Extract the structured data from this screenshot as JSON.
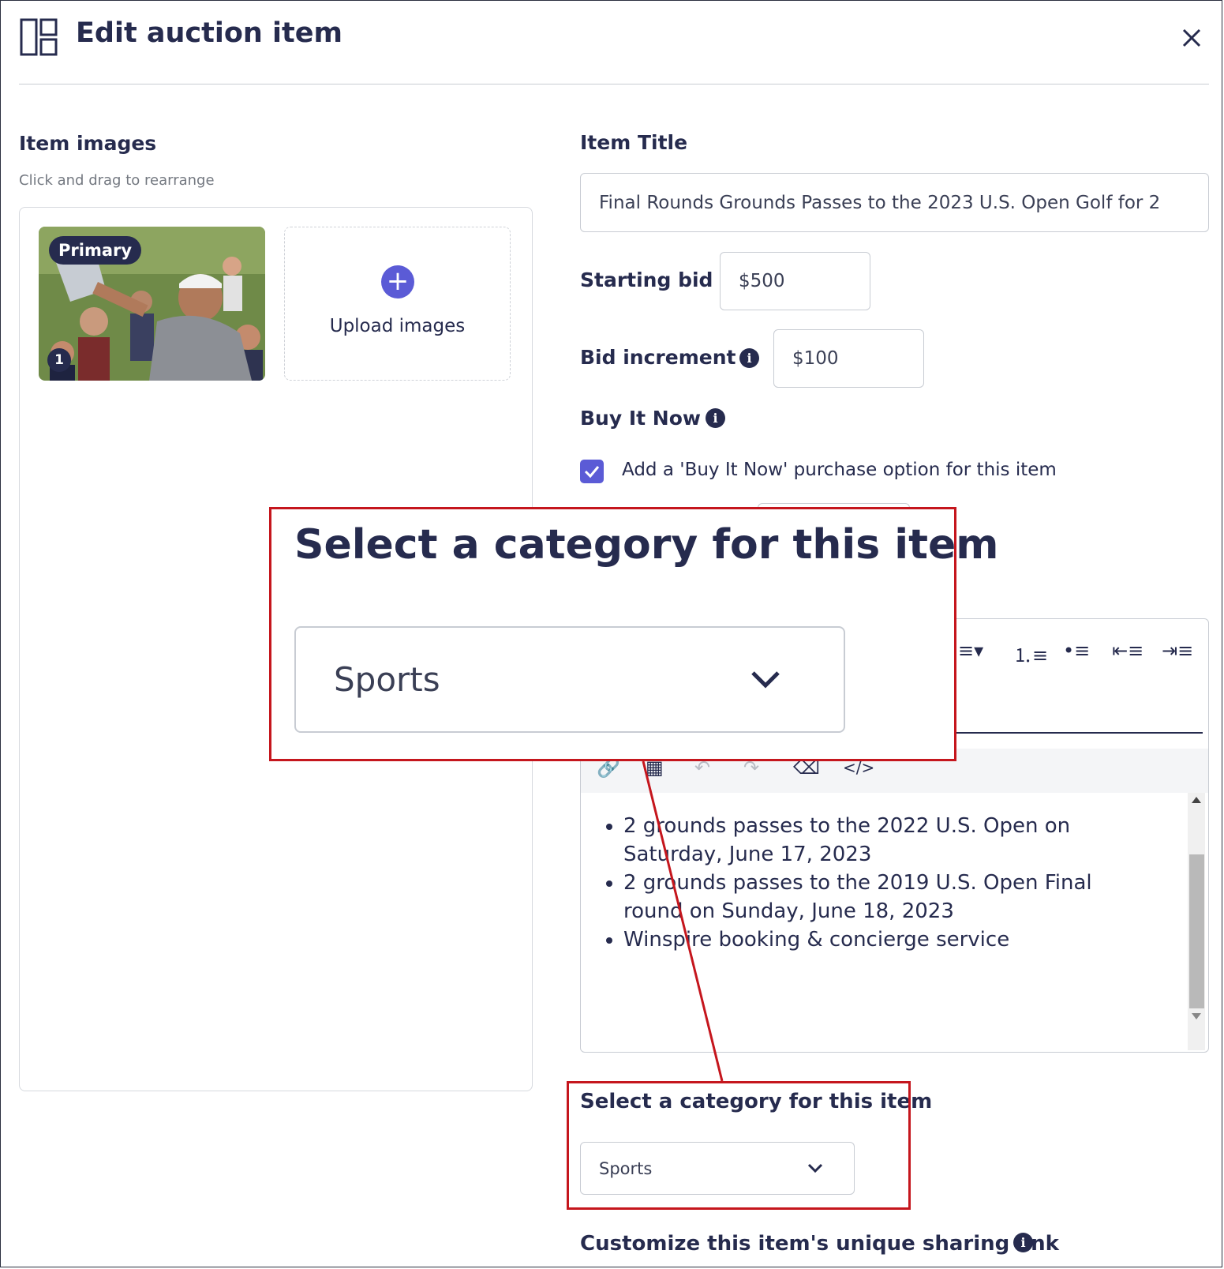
{
  "modal": {
    "title": "Edit auction item",
    "icon": "layout-icon",
    "close_icon": "close-icon"
  },
  "images_section": {
    "label": "Item images",
    "help": "Click and drag to rearrange",
    "primary_badge": "Primary",
    "order_number": "1",
    "upload_label": "Upload images"
  },
  "item_title": {
    "label": "Item Title",
    "value": "Final Rounds Grounds Passes to the 2023 U.S. Open Golf for 2"
  },
  "starting_bid": {
    "label": "Starting bid",
    "value": "$500"
  },
  "bid_increment": {
    "label": "Bid increment",
    "value": "$100"
  },
  "buy_it_now": {
    "label": "Buy It Now",
    "checkbox_label": "Add a 'Buy It Now' purchase option for this item",
    "checked": true
  },
  "description": {
    "items": [
      "2 grounds passes to the 2022 U.S. Open on Saturday, June 17, 2023",
      "2 grounds passes to the 2019 U.S. Open Final round on Sunday, June 18, 2023",
      "Winspire booking & concierge service"
    ]
  },
  "category": {
    "label": "Select a category for this item",
    "value": "Sports"
  },
  "sharing_link": {
    "label": "Customize this item's unique sharing link"
  },
  "colors": {
    "primary_text": "#262b4e",
    "accent": "#5b5bd6",
    "highlight": "#c5161d"
  }
}
